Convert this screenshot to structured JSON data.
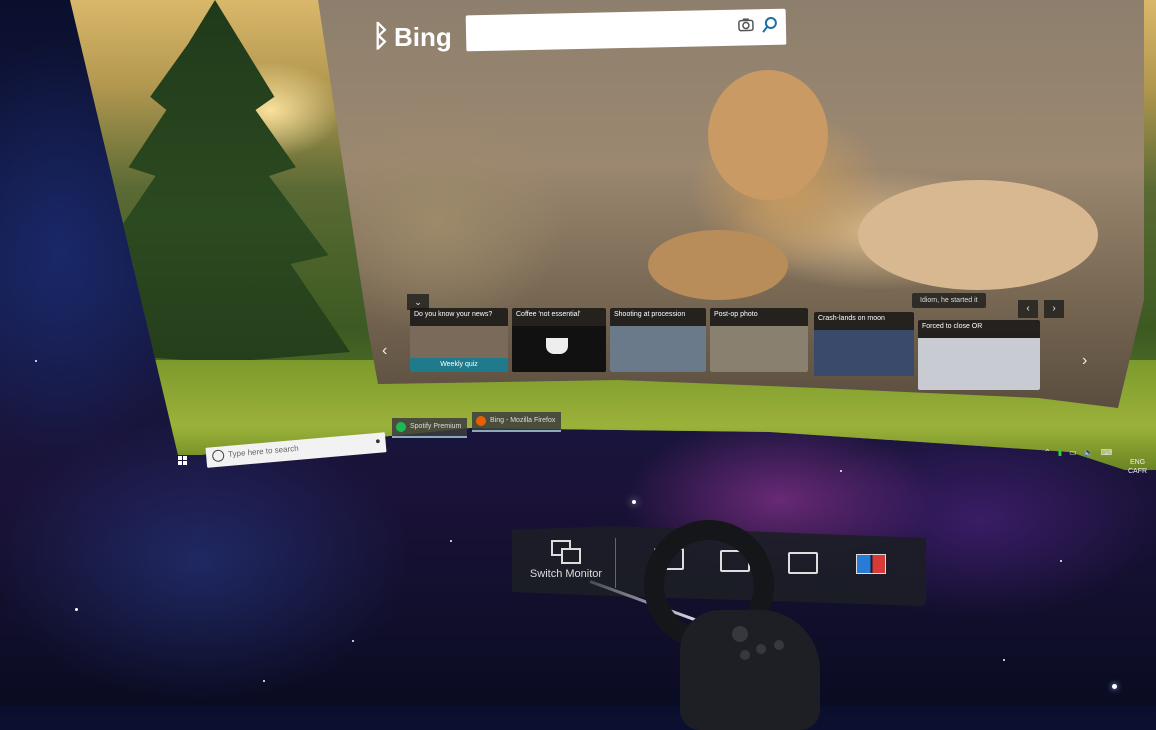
{
  "browser": {
    "brand": "Bing",
    "search_value": "",
    "camera_icon": "camera-icon",
    "search_icon": "search-icon",
    "ticker_text": "Idiom, he started it",
    "news": [
      {
        "title": "Do you know your news?",
        "badge": "Weekly quiz",
        "color": "#7a6a5a"
      },
      {
        "title": "Coffee 'not essential'",
        "color": "#111111"
      },
      {
        "title": "Shooting at procession",
        "color": "#6a7a8a"
      },
      {
        "title": "Post-op photo",
        "color": "#8a8070"
      },
      {
        "title": "Crash-lands on moon",
        "color": "#3a4a6a"
      },
      {
        "title": "Forced to close OR",
        "color": "#c8ccd2"
      }
    ]
  },
  "taskbar": {
    "search_placeholder": "Type here to search",
    "apps": [
      {
        "label": "Spotify Premium",
        "color": "#1db954"
      },
      {
        "label": "Bing - Mozilla Firefox",
        "color": "#e66000"
      }
    ],
    "lang_line1": "ENG",
    "lang_line2": "CAFR"
  },
  "dock": {
    "switch_label": "Switch Monitor"
  },
  "colors": {
    "accent": "#1f7a8c",
    "dock_bg": "#1c1e26"
  }
}
